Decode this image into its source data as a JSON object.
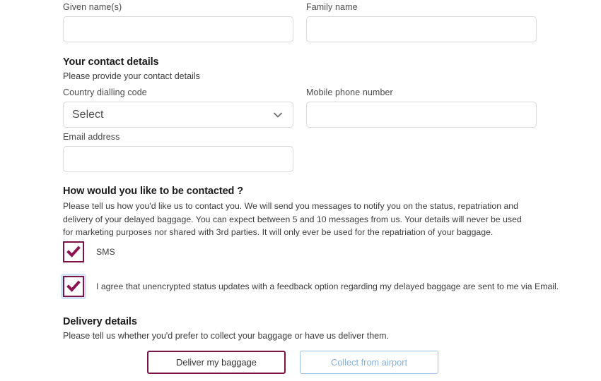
{
  "colors": {
    "brand_maroon": "#7d1448",
    "field_border": "#dadade",
    "focus_ring": "#cfe2f3",
    "secondary_blue": "#86b0dd",
    "secondary_blue_border": "#9cc0e4"
  },
  "name_section": {
    "given_name": {
      "label": "Given name(s)",
      "value": "",
      "placeholder": ""
    },
    "family_name": {
      "label": "Family name",
      "value": "",
      "placeholder": ""
    }
  },
  "contact_section": {
    "title": "Your contact details",
    "subtitle": "Please provide your contact details",
    "country_code": {
      "label": "Country dialling code",
      "selected": "Select",
      "icon": "chevron-down-icon"
    },
    "mobile_phone": {
      "label": "Mobile phone number",
      "value": "",
      "placeholder": ""
    },
    "email": {
      "label": "Email address",
      "value": "",
      "placeholder": ""
    }
  },
  "contact_preference": {
    "title": "How would you like to be contacted ?",
    "description": "Please tell us how you'd like us to contact you. We will send you messages to notify you on the status, repatriation and delivery of your delayed baggage. You can expect between 5 and 10 messages from us. Your details will never be used for marketing purposes nor shared with 3rd parties. It will only ever be used for the repatriation of your baggage.",
    "options": [
      {
        "id": "sms",
        "label": "SMS",
        "checked": true,
        "focused": false,
        "icon": "checkmark-icon"
      },
      {
        "id": "email-consent",
        "label": "I agree that unencrypted status updates with a feedback option regarding my delayed baggage are sent to me via Email.",
        "checked": true,
        "focused": true,
        "icon": "checkmark-icon"
      }
    ]
  },
  "delivery_section": {
    "title": "Delivery details",
    "subtitle": "Please tell us whether you'd prefer to collect your baggage or have us deliver them.",
    "buttons": {
      "deliver": "Deliver my baggage",
      "collect": "Collect from airport"
    }
  }
}
